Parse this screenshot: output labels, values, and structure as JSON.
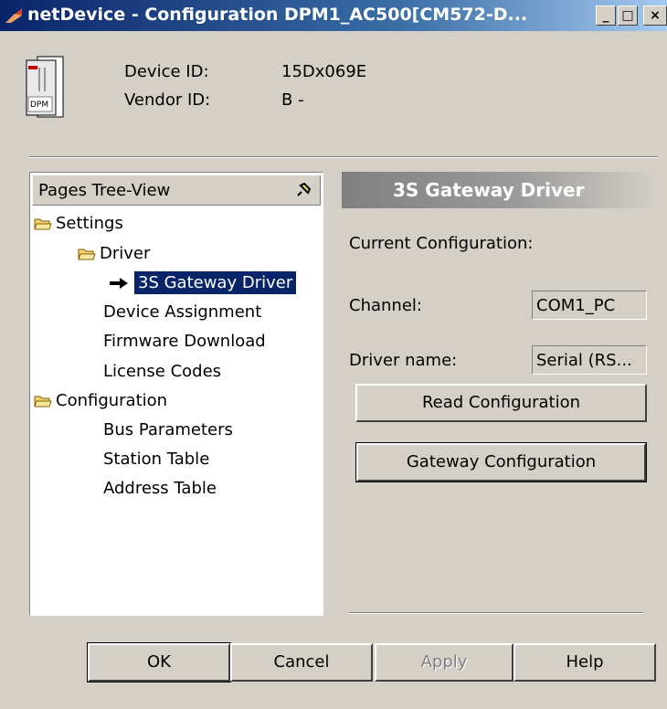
{
  "window": {
    "title": "netDevice - Configuration DPM1_AC500[CM572-D...",
    "controls": {
      "minimize": "_",
      "maximize": "□",
      "close": "×"
    }
  },
  "device": {
    "icon_label": "DPM",
    "device_id_label": "Device ID:",
    "device_id_value": "15Dx069E",
    "vendor_id_label": "Vendor ID:",
    "vendor_id_value": "B -"
  },
  "tree": {
    "header": "Pages Tree-View",
    "items": [
      {
        "label": "Settings"
      },
      {
        "label": "Driver"
      },
      {
        "label": "3S Gateway Driver"
      },
      {
        "label": "Device Assignment"
      },
      {
        "label": "Firmware Download"
      },
      {
        "label": "License Codes"
      },
      {
        "label": "Configuration"
      },
      {
        "label": "Bus Parameters"
      },
      {
        "label": "Station Table"
      },
      {
        "label": "Address Table"
      }
    ]
  },
  "panel": {
    "title": "3S Gateway Driver",
    "current_config_label": "Current Configuration:",
    "channel_label": "Channel:",
    "channel_value": "COM1_PC",
    "driver_name_label": "Driver name:",
    "driver_name_value": "Serial (RS...",
    "read_config_button": "Read Configuration",
    "gateway_config_button": "Gateway Configuration"
  },
  "footer": {
    "ok": "OK",
    "cancel": "Cancel",
    "apply": "Apply",
    "help": "Help"
  },
  "colors": {
    "titlebar": "#0a246a",
    "selection": "#0a246a",
    "face": "#d4d0c8",
    "folder": "#f0d070"
  }
}
